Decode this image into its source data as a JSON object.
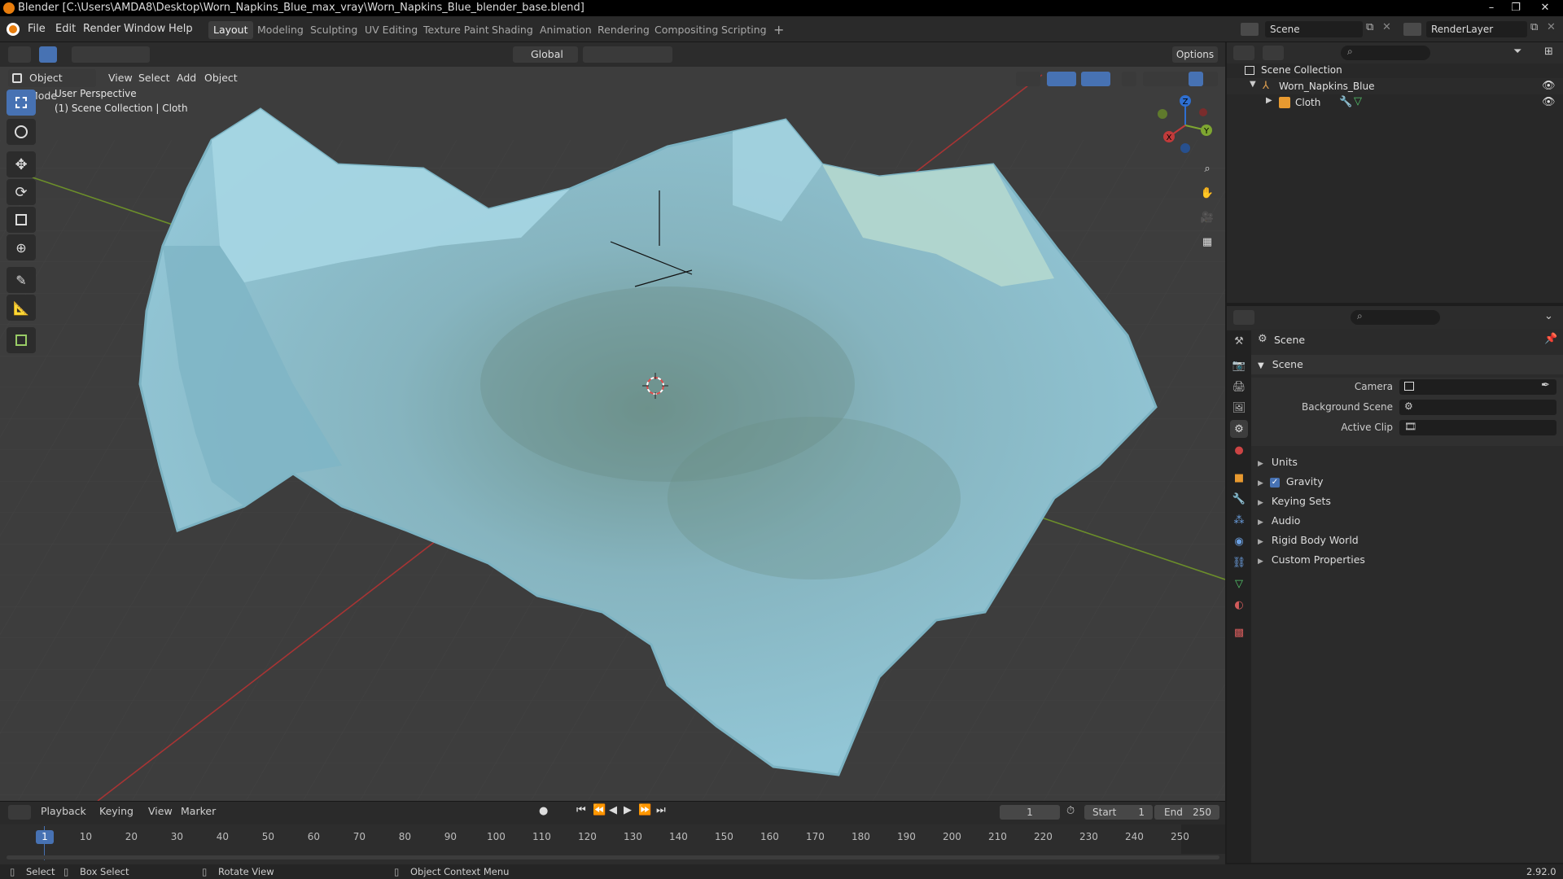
{
  "window": {
    "title": "Blender [C:\\Users\\AMDA8\\Desktop\\Worn_Napkins_Blue_max_vray\\Worn_Napkins_Blue_blender_base.blend]"
  },
  "menu": [
    "File",
    "Edit",
    "Render",
    "Window",
    "Help"
  ],
  "workspaces": [
    "Layout",
    "Modeling",
    "Sculpting",
    "UV Editing",
    "Texture Paint",
    "Shading",
    "Animation",
    "Rendering",
    "Compositing",
    "Scripting"
  ],
  "active_workspace": "Layout",
  "scene_selector": {
    "value": "Scene"
  },
  "renderlayer_selector": {
    "value": "RenderLayer"
  },
  "viewport": {
    "orientation": "Global",
    "options_label": "Options",
    "mode": "Object Mode",
    "menus": [
      "View",
      "Select",
      "Add",
      "Object"
    ],
    "overlay_line1": "User Perspective",
    "overlay_line2": "(1) Scene Collection | Cloth",
    "gizmo": {
      "x": "X",
      "y": "Y",
      "z": "Z"
    }
  },
  "outliner": {
    "root": "Scene Collection",
    "items": [
      {
        "label": "Worn_Napkins_Blue"
      },
      {
        "label": "Cloth"
      }
    ]
  },
  "properties": {
    "header": "Scene",
    "section": "Scene",
    "fields": [
      {
        "label": "Camera"
      },
      {
        "label": "Background Scene"
      },
      {
        "label": "Active Clip"
      }
    ],
    "panels": [
      "Units",
      "Gravity",
      "Keying Sets",
      "Audio",
      "Rigid Body World",
      "Custom Properties"
    ],
    "gravity_checked": true
  },
  "timeline": {
    "menus": [
      "Playback",
      "Keying",
      "View",
      "Marker"
    ],
    "current_frame": "1",
    "start_label": "Start",
    "start": "1",
    "end_label": "End",
    "end": "250",
    "ticks": [
      "1",
      "10",
      "20",
      "30",
      "40",
      "50",
      "60",
      "70",
      "80",
      "90",
      "100",
      "110",
      "120",
      "130",
      "140",
      "150",
      "160",
      "170",
      "180",
      "190",
      "200",
      "210",
      "220",
      "230",
      "240",
      "250"
    ]
  },
  "status": {
    "select": "Select",
    "box_select": "Box Select",
    "rotate_view": "Rotate View",
    "context_menu": "Object Context Menu",
    "version": "2.92.0"
  },
  "colors": {
    "accent": "#4772b3",
    "cloth": "#8ec3d2",
    "axis_x": "#c13a3a",
    "axis_y": "#7ea631",
    "axis_z": "#2e6fd1"
  }
}
